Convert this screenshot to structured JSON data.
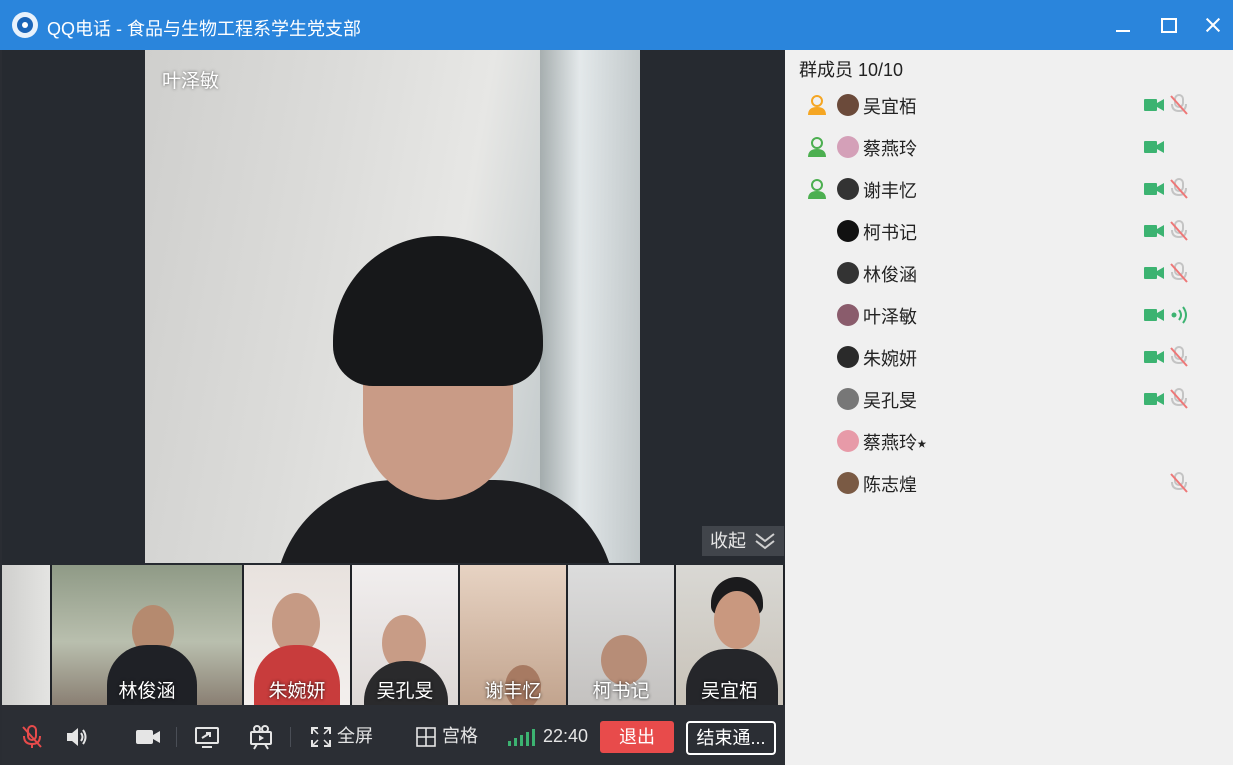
{
  "window": {
    "title": "QQ电话  -  食品与生物工程系学生党支部"
  },
  "main_video": {
    "speaker_name": "叶泽敏",
    "collapse_label": "收起"
  },
  "thumbnails": [
    {
      "name": ""
    },
    {
      "name": "林俊涵"
    },
    {
      "name": "朱婉妍"
    },
    {
      "name": "吴孔旻"
    },
    {
      "name": "谢丰忆"
    },
    {
      "name": "柯书记"
    },
    {
      "name": "吴宜栢"
    }
  ],
  "toolbar": {
    "fullscreen_label": "全屏",
    "grid_label": "宫格",
    "time": "22:40",
    "exit_label": "退出",
    "end_label": "结束通..."
  },
  "members": {
    "header": "群成员 10/10",
    "list": [
      {
        "name": "吴宜栢",
        "admin": "orange",
        "camera": true,
        "mic": "muted"
      },
      {
        "name": "蔡燕玲",
        "admin": "green",
        "camera": true,
        "mic": "none"
      },
      {
        "name": "谢丰忆",
        "admin": "green",
        "camera": true,
        "mic": "muted"
      },
      {
        "name": "柯书记",
        "admin": "none",
        "camera": true,
        "mic": "muted"
      },
      {
        "name": "林俊涵",
        "admin": "none",
        "camera": true,
        "mic": "muted"
      },
      {
        "name": "叶泽敏",
        "admin": "none",
        "camera": true,
        "mic": "speaking"
      },
      {
        "name": "朱婉妍",
        "admin": "none",
        "camera": true,
        "mic": "muted"
      },
      {
        "name": "吴孔旻",
        "admin": "none",
        "camera": true,
        "mic": "muted"
      },
      {
        "name": "蔡燕玲⭑",
        "admin": "none",
        "camera": false,
        "mic": "none"
      },
      {
        "name": "陈志煌",
        "admin": "none",
        "camera": false,
        "mic": "muted"
      }
    ]
  },
  "colors": {
    "titlebar": "#2a85dc",
    "accent_green": "#3cb371",
    "exit_red": "#e84b4b",
    "muted_icon": "#c4c4c4"
  }
}
